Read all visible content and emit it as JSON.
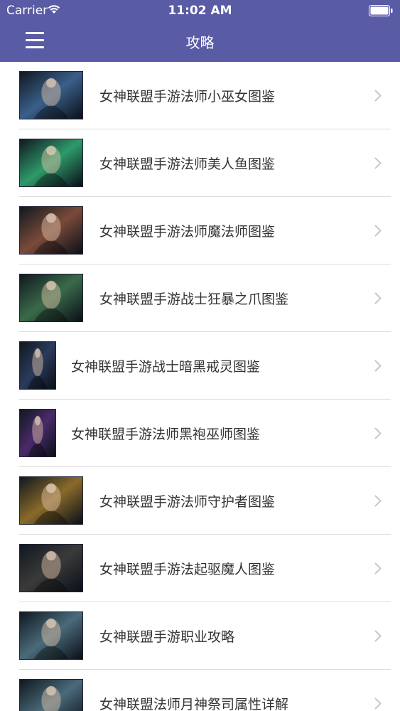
{
  "status_bar": {
    "carrier": "Carrier",
    "time": "11:02 AM",
    "icons": {
      "wifi": "wifi-icon",
      "battery": "battery-icon"
    }
  },
  "nav": {
    "title": "攻略",
    "menu_icon": "hamburger-menu-icon"
  },
  "colors": {
    "nav_background": "#5a5ba5",
    "text": "#333333",
    "separator": "#dcdcdc",
    "chevron": "#c7c7cc"
  },
  "list": {
    "items": [
      {
        "label": "女神联盟手游法师小巫女图鉴",
        "thumb": "wide",
        "tint": "#3a5f8a"
      },
      {
        "label": "女神联盟手游法师美人鱼图鉴",
        "thumb": "wide",
        "tint": "#2e9a6a"
      },
      {
        "label": "女神联盟手游法师魔法师图鉴",
        "thumb": "wide",
        "tint": "#7a4a3a"
      },
      {
        "label": "女神联盟手游战士狂暴之爪图鉴",
        "thumb": "wide",
        "tint": "#3a6a4a"
      },
      {
        "label": "女神联盟手游战士暗黑戒灵图鉴",
        "thumb": "narrow",
        "tint": "#2a3a5a"
      },
      {
        "label": "女神联盟手游法师黑袍巫师图鉴",
        "thumb": "narrow",
        "tint": "#4a2a6a"
      },
      {
        "label": "女神联盟手游法师守护者图鉴",
        "thumb": "wide",
        "tint": "#8a6a2a"
      },
      {
        "label": "女神联盟手游法起驱魔人图鉴",
        "thumb": "wide",
        "tint": "#3a3a3a"
      },
      {
        "label": "女神联盟手游职业攻略",
        "thumb": "wide",
        "tint": "#4a6a7a"
      },
      {
        "label": "女神联盟法师月神祭司属性详解",
        "thumb": "wide",
        "tint": "#4a6a7a"
      }
    ]
  }
}
